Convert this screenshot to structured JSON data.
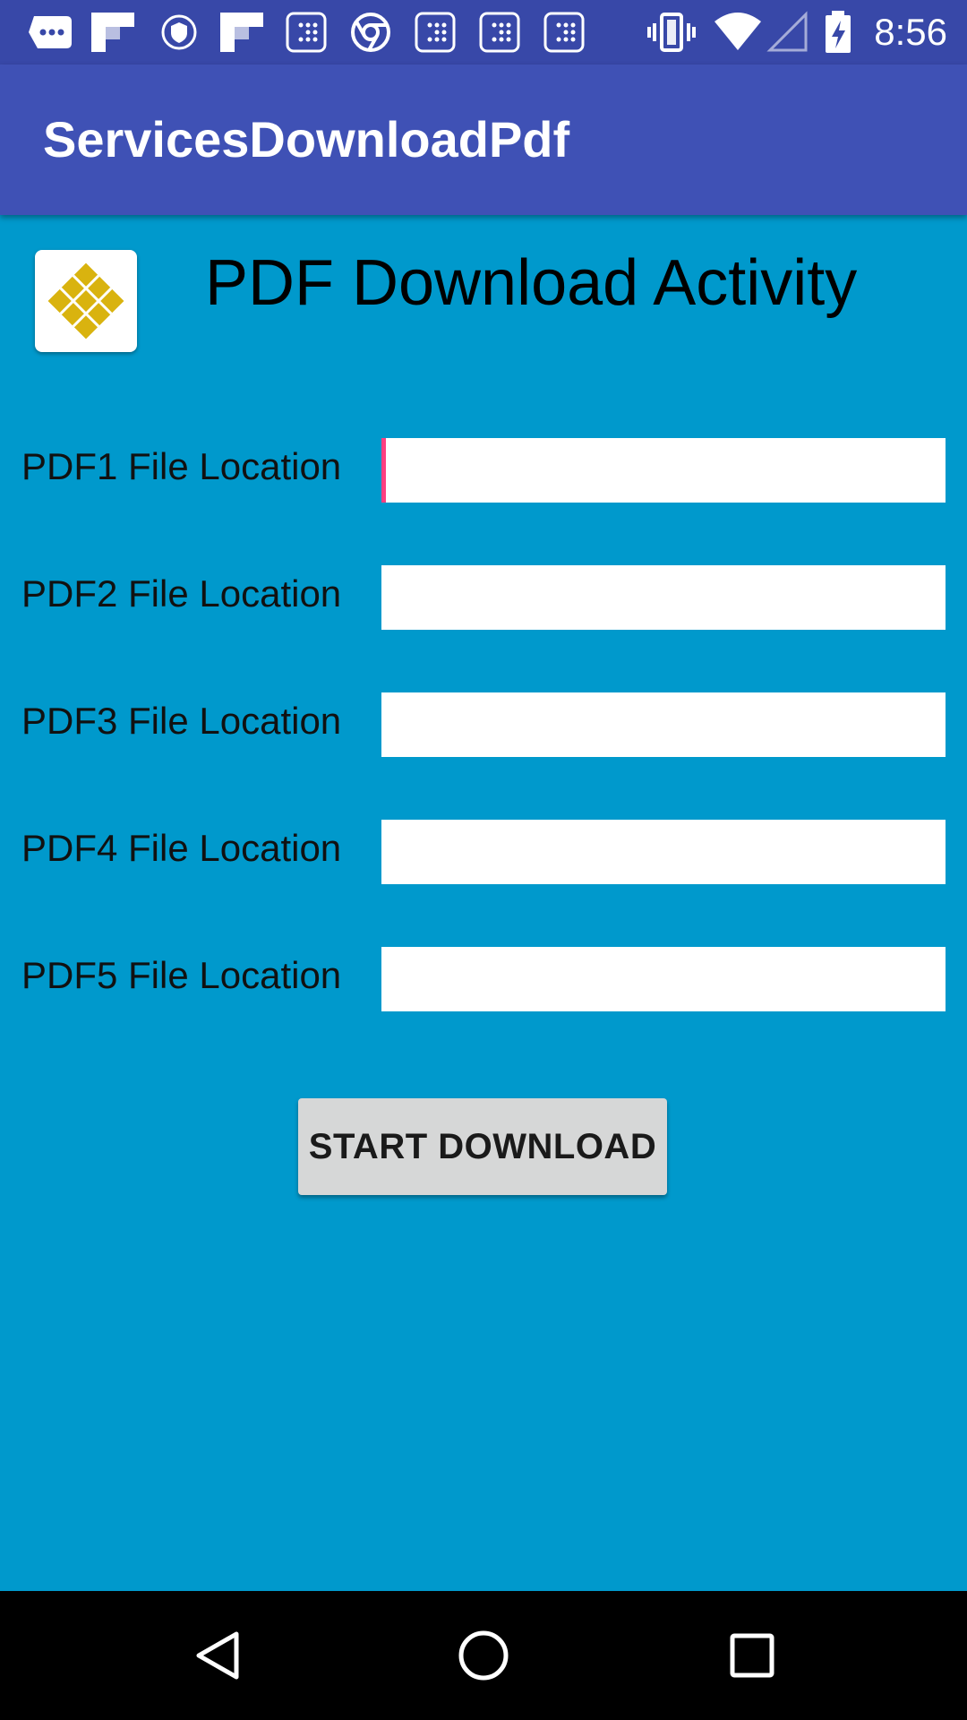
{
  "status_bar": {
    "time": "8:56",
    "notification_icons": [
      "message-icon",
      "flipboard-icon",
      "vpn-shield-icon",
      "flipboard-icon",
      "app-grid-icon",
      "chrome-icon",
      "app-grid-icon",
      "app-grid-icon",
      "app-grid-icon"
    ],
    "system_icons": [
      "vibrate-icon",
      "wifi-icon",
      "cell-signal-icon",
      "battery-charging-icon"
    ]
  },
  "app_bar": {
    "title": "ServicesDownloadPdf"
  },
  "header": {
    "title": "PDF Download Activity",
    "logo_icon": "app-logo-icon",
    "logo_color": "#D9B30F"
  },
  "form": {
    "rows": [
      {
        "label": "PDF1 File Location",
        "value": "",
        "focused": true
      },
      {
        "label": "PDF2 File Location",
        "value": ""
      },
      {
        "label": "PDF3 File Location",
        "value": ""
      },
      {
        "label": "PDF4 File Location",
        "value": ""
      },
      {
        "label": "PDF5 File Location",
        "value": ""
      }
    ],
    "button_label": "START DOWNLOAD"
  },
  "nav_bar": {
    "buttons": [
      "back-icon",
      "home-icon",
      "recents-icon"
    ]
  },
  "colors": {
    "status_bar": "#3848A8",
    "app_bar": "#3F51B5",
    "background": "#0099CC",
    "accent": "#FF4081",
    "button": "#D6D7D7"
  }
}
